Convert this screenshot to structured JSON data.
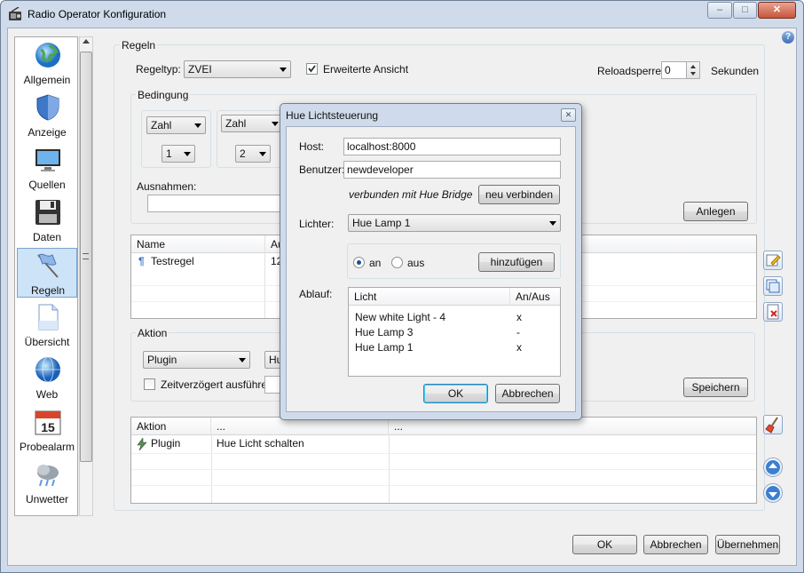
{
  "window": {
    "title": "Radio Operator Konfiguration",
    "minimize": "–",
    "maximize": "□",
    "close": "✕",
    "help": "?"
  },
  "sidebar": {
    "items": [
      {
        "label": "Allgemein",
        "icon": "globe-icon"
      },
      {
        "label": "Anzeige",
        "icon": "shield-icon"
      },
      {
        "label": "Quellen",
        "icon": "monitor-icon"
      },
      {
        "label": "Daten",
        "icon": "floppy-disk-icon"
      },
      {
        "label": "Regeln",
        "icon": "flag-icon",
        "selected": true
      },
      {
        "label": "Übersicht",
        "icon": "document-icon"
      },
      {
        "label": "Web",
        "icon": "globe-icon"
      },
      {
        "label": "Probealarm",
        "icon": "calendar-icon",
        "day": "15"
      },
      {
        "label": "Unwetter",
        "icon": "storm-cloud-icon"
      }
    ]
  },
  "rules": {
    "group_title": "Regeln",
    "type_label": "Regeltyp:",
    "type_value": "ZVEI",
    "extended_view_label": "Erweiterte Ansicht",
    "reload_label": "Reloadsperre:",
    "reload_value": "0",
    "reload_unit": "Sekunden",
    "condition": {
      "title": "Bedingung",
      "col1_type": "Zahl",
      "col1_digit": "1",
      "col2_type": "Zahl",
      "col2_digit": "2",
      "exceptions_label": "Ausnahmen:",
      "add_button": "Anlegen"
    },
    "rules_table": {
      "headers": [
        "Name",
        "Au"
      ],
      "rows": [
        {
          "name": "Testregel",
          "value": "12"
        }
      ]
    },
    "action": {
      "title": "Aktion",
      "type_value": "Plugin",
      "plugin_value": "Hu",
      "delayed_label": "Zeitverzögert ausführen",
      "save_button": "Speichern"
    },
    "action_table": {
      "headers": [
        "Aktion",
        "...",
        "..."
      ],
      "rows": [
        {
          "action": "Plugin",
          "detail": "Hue Licht schalten"
        }
      ]
    }
  },
  "footer": {
    "ok": "OK",
    "cancel": "Abbrechen",
    "apply": "Übernehmen"
  },
  "dialog": {
    "title": "Hue Lichtsteuerung",
    "close": "✕",
    "host_label": "Host:",
    "host_value": "localhost:8000",
    "user_label": "Benutzer:",
    "user_value": "newdeveloper",
    "status": "verbunden mit Hue Bridge",
    "reconnect_button": "neu verbinden",
    "lights_label": "Lichter:",
    "lights_value": "Hue Lamp 1",
    "on_label": "an",
    "off_label": "aus",
    "state": "an",
    "add_button": "hinzufügen",
    "sequence_label": "Ablauf:",
    "sequence_headers": [
      "Licht",
      "An/Aus"
    ],
    "sequence": [
      {
        "light": "New white Light - 4",
        "state": "x"
      },
      {
        "light": "Hue Lamp 3",
        "state": "-"
      },
      {
        "light": "Hue Lamp 1",
        "state": "x"
      }
    ],
    "ok": "OK",
    "cancel": "Abbrechen"
  }
}
